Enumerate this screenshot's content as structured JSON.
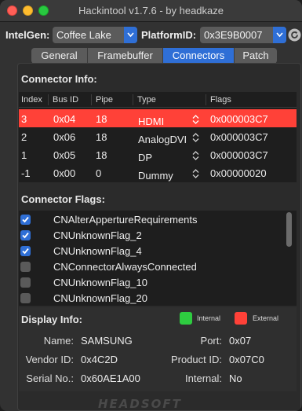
{
  "window": {
    "title": "Hackintool v1.7.6 - by headkaze"
  },
  "toolbar": {
    "intelgen_label": "IntelGen:",
    "intelgen_value": "Coffee Lake",
    "platformid_label": "PlatformID:",
    "platformid_value": "0x3E9B0007"
  },
  "tabs": [
    {
      "label": "General",
      "active": false
    },
    {
      "label": "Framebuffer",
      "active": false
    },
    {
      "label": "Connectors",
      "active": true
    },
    {
      "label": "Patch",
      "active": false
    }
  ],
  "connector_info": {
    "title": "Connector Info:",
    "columns": [
      "Index",
      "Bus ID",
      "Pipe",
      "Type",
      "Flags"
    ],
    "rows": [
      {
        "index": "3",
        "bus_id": "0x04",
        "pipe": "18",
        "type": "HDMI",
        "flags": "0x000003C7",
        "selected": true
      },
      {
        "index": "2",
        "bus_id": "0x06",
        "pipe": "18",
        "type": "AnalogDVI",
        "flags": "0x000003C7",
        "selected": false
      },
      {
        "index": "1",
        "bus_id": "0x05",
        "pipe": "18",
        "type": "DP",
        "flags": "0x000003C7",
        "selected": false
      },
      {
        "index": "-1",
        "bus_id": "0x00",
        "pipe": "0",
        "type": "Dummy",
        "flags": "0x00000020",
        "selected": false
      }
    ]
  },
  "connector_flags": {
    "title": "Connector Flags:",
    "items": [
      {
        "label": "CNAlterAppertureRequirements",
        "checked": true
      },
      {
        "label": "CNUnknownFlag_2",
        "checked": true
      },
      {
        "label": "CNUnknownFlag_4",
        "checked": true
      },
      {
        "label": "CNConnectorAlwaysConnected",
        "checked": false
      },
      {
        "label": "CNUnknownFlag_10",
        "checked": false
      },
      {
        "label": "CNUnknownFlag_20",
        "checked": false
      }
    ]
  },
  "display_info": {
    "title": "Display Info:",
    "legend_internal": "Internal",
    "legend_external": "External",
    "name_label": "Name:",
    "name_value": "SAMSUNG",
    "port_label": "Port:",
    "port_value": "0x07",
    "vendor_label": "Vendor ID:",
    "vendor_value": "0x4C2D",
    "product_label": "Product ID:",
    "product_value": "0x07C0",
    "serial_label": "Serial No.:",
    "serial_value": "0x60AE1A00",
    "internal_label": "Internal:",
    "internal_value": "No"
  },
  "footer": {
    "logo_text": "HEADSOFT"
  },
  "colors": {
    "accent": "#2f6fd6",
    "selection": "#ff4138",
    "internal": "#2ecc40",
    "external": "#ff4138"
  }
}
